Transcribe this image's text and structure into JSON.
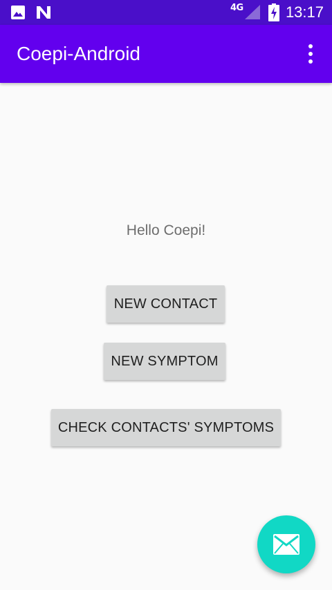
{
  "status_bar": {
    "network": "4G",
    "time": "13:17",
    "icons": [
      "image-icon",
      "n-icon",
      "signal-icon",
      "battery-charging-icon"
    ]
  },
  "app_bar": {
    "title": "Coepi-Android",
    "overflow_icon": "more-vert-icon"
  },
  "content": {
    "greeting": "Hello Coepi!",
    "buttons": {
      "new_contact": "NEW CONTACT",
      "new_symptom": "NEW SYMPTOM",
      "check_contacts_symptoms": "CHECK CONTACTS' SYMPTOMS"
    }
  },
  "fab": {
    "icon": "email-icon"
  },
  "colors": {
    "status_bar": "#4a0fc9",
    "app_bar": "#6200ee",
    "fab": "#11d8c5",
    "button": "#d6d7d7",
    "background": "#fafafa"
  }
}
